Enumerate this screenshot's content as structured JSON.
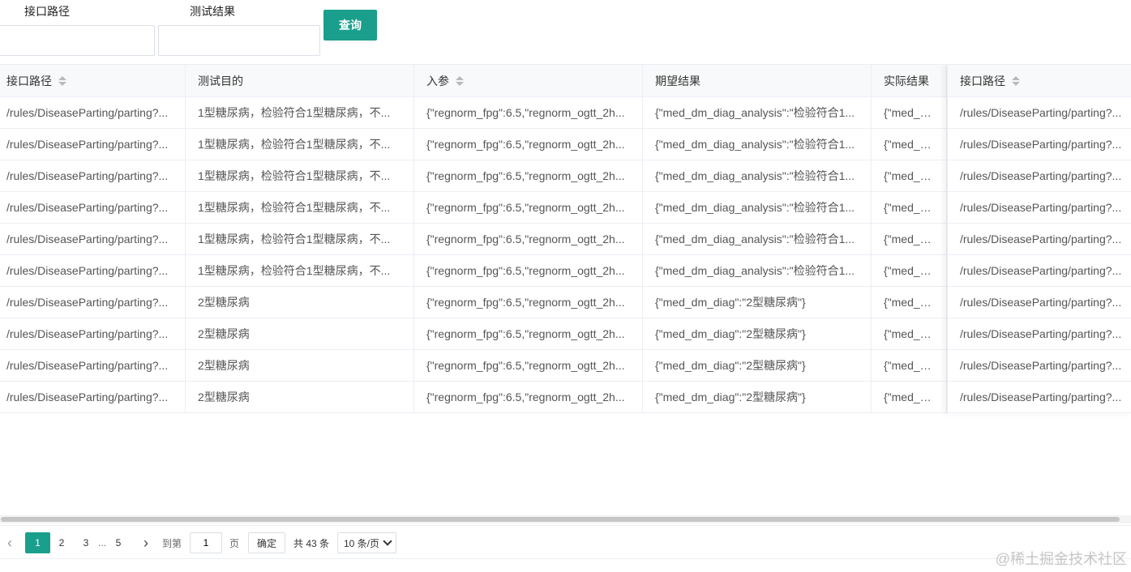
{
  "filters": {
    "path_label": "接口路径",
    "result_label": "测试结果",
    "path_value": "",
    "result_value": "",
    "query_label": "查询"
  },
  "table": {
    "headers": [
      "接口路径",
      "测试目的",
      "入参",
      "期望结果",
      "实际结果"
    ],
    "fixed_header": "接口路径",
    "rows": [
      [
        "/rules/DiseaseParting/parting?...",
        "1型糖尿病，检验符合1型糖尿病，不...",
        "{\"regnorm_fpg\":6.5,\"regnorm_ogtt_2h...",
        "{\"med_dm_diag_analysis\":\"检验符合1...",
        "{\"med_dm_c",
        "/rules/DiseaseParting/parting?..."
      ],
      [
        "/rules/DiseaseParting/parting?...",
        "1型糖尿病，检验符合1型糖尿病，不...",
        "{\"regnorm_fpg\":6.5,\"regnorm_ogtt_2h...",
        "{\"med_dm_diag_analysis\":\"检验符合1...",
        "{\"med_dm_c",
        "/rules/DiseaseParting/parting?..."
      ],
      [
        "/rules/DiseaseParting/parting?...",
        "1型糖尿病，检验符合1型糖尿病，不...",
        "{\"regnorm_fpg\":6.5,\"regnorm_ogtt_2h...",
        "{\"med_dm_diag_analysis\":\"检验符合1...",
        "{\"med_dm_c",
        "/rules/DiseaseParting/parting?..."
      ],
      [
        "/rules/DiseaseParting/parting?...",
        "1型糖尿病，检验符合1型糖尿病，不...",
        "{\"regnorm_fpg\":6.5,\"regnorm_ogtt_2h...",
        "{\"med_dm_diag_analysis\":\"检验符合1...",
        "{\"med_dm_c",
        "/rules/DiseaseParting/parting?..."
      ],
      [
        "/rules/DiseaseParting/parting?...",
        "1型糖尿病，检验符合1型糖尿病，不...",
        "{\"regnorm_fpg\":6.5,\"regnorm_ogtt_2h...",
        "{\"med_dm_diag_analysis\":\"检验符合1...",
        "{\"med_dm_c",
        "/rules/DiseaseParting/parting?..."
      ],
      [
        "/rules/DiseaseParting/parting?...",
        "1型糖尿病，检验符合1型糖尿病，不...",
        "{\"regnorm_fpg\":6.5,\"regnorm_ogtt_2h...",
        "{\"med_dm_diag_analysis\":\"检验符合1...",
        "{\"med_dm_c",
        "/rules/DiseaseParting/parting?..."
      ],
      [
        "/rules/DiseaseParting/parting?...",
        "2型糖尿病",
        "{\"regnorm_fpg\":6.5,\"regnorm_ogtt_2h...",
        "{\"med_dm_diag\":\"2型糖尿病\"}",
        "{\"med_dm_c",
        "/rules/DiseaseParting/parting?..."
      ],
      [
        "/rules/DiseaseParting/parting?...",
        "2型糖尿病",
        "{\"regnorm_fpg\":6.5,\"regnorm_ogtt_2h...",
        "{\"med_dm_diag\":\"2型糖尿病\"}",
        "{\"med_dm_c",
        "/rules/DiseaseParting/parting?..."
      ],
      [
        "/rules/DiseaseParting/parting?...",
        "2型糖尿病",
        "{\"regnorm_fpg\":6.5,\"regnorm_ogtt_2h...",
        "{\"med_dm_diag\":\"2型糖尿病\"}",
        "{\"med_dm_c",
        "/rules/DiseaseParting/parting?..."
      ],
      [
        "/rules/DiseaseParting/parting?...",
        "2型糖尿病",
        "{\"regnorm_fpg\":6.5,\"regnorm_ogtt_2h...",
        "{\"med_dm_diag\":\"2型糖尿病\"}",
        "{\"med_dm_c",
        "/rules/DiseaseParting/parting?..."
      ]
    ]
  },
  "pagination": {
    "prev": "‹",
    "next": "›",
    "pages": [
      "1",
      "2",
      "3"
    ],
    "ellipsis": "...",
    "last_page": "5",
    "current": "1",
    "goto_prefix": "到第",
    "goto_value": "1",
    "goto_suffix": "页",
    "confirm": "确定",
    "total": "共 43 条",
    "page_size": "10 条/页"
  },
  "watermark": "@稀土掘金技术社区",
  "colors": {
    "accent": "#1a9f8c",
    "border": "#ebeef5",
    "header_bg": "#f8f9fa"
  }
}
